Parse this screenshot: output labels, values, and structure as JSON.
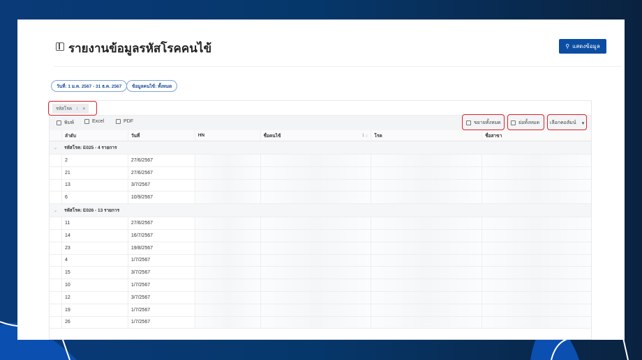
{
  "header": {
    "title": "รายงานข้อมูลรหัสโรคคนไข้",
    "show_button": "แสดงข้อมูล"
  },
  "filters": [
    "วันที่: 1 ม.ค. 2567 - 31 ธ.ค. 2567",
    "ข้อมูลคนไข้: ทั้งหมด"
  ],
  "grouping": {
    "label": "รหัสโรค",
    "sort": "↑",
    "remove": "×"
  },
  "toolbar": {
    "print": "พิมพ์",
    "excel": "Excel",
    "pdf": "PDF",
    "expand_all": "ขยายทั้งหมด",
    "collapse_all": "ย่อทั้งหมด",
    "choose_columns": "เลือกคอลัมน์"
  },
  "columns": [
    "ลำดับ",
    "วันที่",
    "HN",
    "ชื่อคนไข้",
    "โรค",
    "ชื่อสาขา"
  ],
  "sort_badge": "1",
  "groups": [
    {
      "label": "รหัสโรค: E025 - 4 รายการ",
      "rows": [
        [
          "2",
          "27/6/2567"
        ],
        [
          "21",
          "27/6/2567"
        ],
        [
          "13",
          "3/7/2567"
        ],
        [
          "6",
          "10/9/2567"
        ]
      ]
    },
    {
      "label": "รหัสโรค: E026 - 13 รายการ",
      "rows": [
        [
          "11",
          "27/6/2567"
        ],
        [
          "14",
          "16/7/2567"
        ],
        [
          "23",
          "19/8/2567"
        ],
        [
          "4",
          "1/7/2567"
        ],
        [
          "15",
          "3/7/2567"
        ],
        [
          "10",
          "1/7/2567"
        ],
        [
          "12",
          "3/7/2567"
        ],
        [
          "19",
          "1/7/2567"
        ],
        [
          "26",
          "1/7/2567"
        ]
      ]
    }
  ]
}
